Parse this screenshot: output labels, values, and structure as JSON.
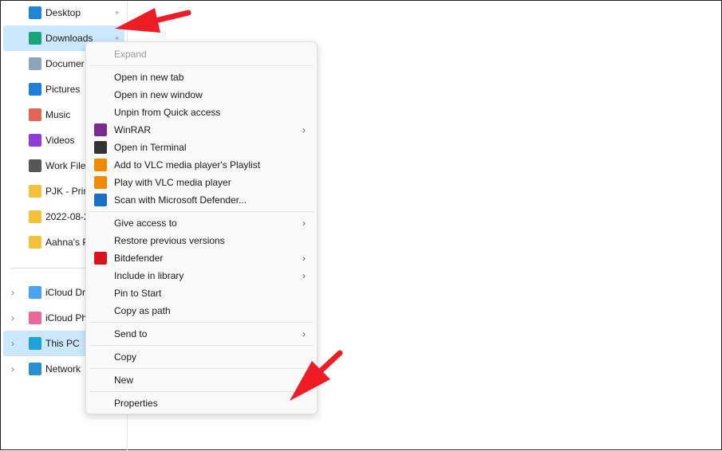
{
  "sidebar": {
    "items": [
      {
        "label": "Desktop",
        "icon": "desktop-icon",
        "color": "#1e88d4",
        "pinned": true
      },
      {
        "label": "Downloads",
        "icon": "download-icon",
        "color": "#1aa37a",
        "pinned": true,
        "selected": true
      },
      {
        "label": "Documer",
        "icon": "document-icon",
        "color": "#8fa3b8"
      },
      {
        "label": "Pictures",
        "icon": "pictures-icon",
        "color": "#1e7fd6"
      },
      {
        "label": "Music",
        "icon": "music-icon",
        "color": "#e0665a"
      },
      {
        "label": "Videos",
        "icon": "videos-icon",
        "color": "#8b3fd6"
      },
      {
        "label": "Work File",
        "icon": "drive-icon",
        "color": "#555555"
      },
      {
        "label": "PJK - Prin",
        "icon": "folder-icon",
        "color": "#f2c23a"
      },
      {
        "label": "2022-08-2",
        "icon": "folder-icon",
        "color": "#f2c23a"
      },
      {
        "label": "Aahna's P",
        "icon": "folder-icon",
        "color": "#f2c23a"
      }
    ],
    "bottom": [
      {
        "label": "iCloud Dr",
        "icon": "icloud-drive-icon",
        "color": "#4aa3f0"
      },
      {
        "label": "iCloud Ph",
        "icon": "icloud-photos-icon",
        "color": "#e86a9c"
      },
      {
        "label": "This PC",
        "icon": "this-pc-icon",
        "color": "#1fa3d6",
        "selected": true
      },
      {
        "label": "Network",
        "icon": "network-icon",
        "color": "#2a8fd0"
      }
    ]
  },
  "menu": {
    "items": [
      {
        "label": "Expand",
        "disabled": true
      },
      {
        "sep": true
      },
      {
        "label": "Open in new tab"
      },
      {
        "label": "Open in new window"
      },
      {
        "label": "Unpin from Quick access"
      },
      {
        "label": "WinRAR",
        "icon": "winrar-icon",
        "color": "#7a2b8f",
        "submenu": true
      },
      {
        "label": "Open in Terminal",
        "icon": "terminal-icon",
        "color": "#333333"
      },
      {
        "label": "Add to VLC media player's Playlist",
        "icon": "vlc-icon",
        "color": "#f08a00"
      },
      {
        "label": "Play with VLC media player",
        "icon": "vlc-icon",
        "color": "#f08a00"
      },
      {
        "label": "Scan with Microsoft Defender...",
        "icon": "defender-shield-icon",
        "color": "#1a6fc4"
      },
      {
        "sep": true
      },
      {
        "label": "Give access to",
        "submenu": true
      },
      {
        "label": "Restore previous versions"
      },
      {
        "label": "Bitdefender",
        "icon": "bitdefender-icon",
        "color": "#d8131b",
        "submenu": true
      },
      {
        "label": "Include in library",
        "submenu": true
      },
      {
        "label": "Pin to Start"
      },
      {
        "label": "Copy as path"
      },
      {
        "sep": true
      },
      {
        "label": "Send to",
        "submenu": true
      },
      {
        "sep": true
      },
      {
        "label": "Copy"
      },
      {
        "sep": true
      },
      {
        "label": "New",
        "submenu": true
      },
      {
        "sep": true
      },
      {
        "label": "Properties"
      }
    ]
  },
  "annotation_color": "#ee1c25"
}
